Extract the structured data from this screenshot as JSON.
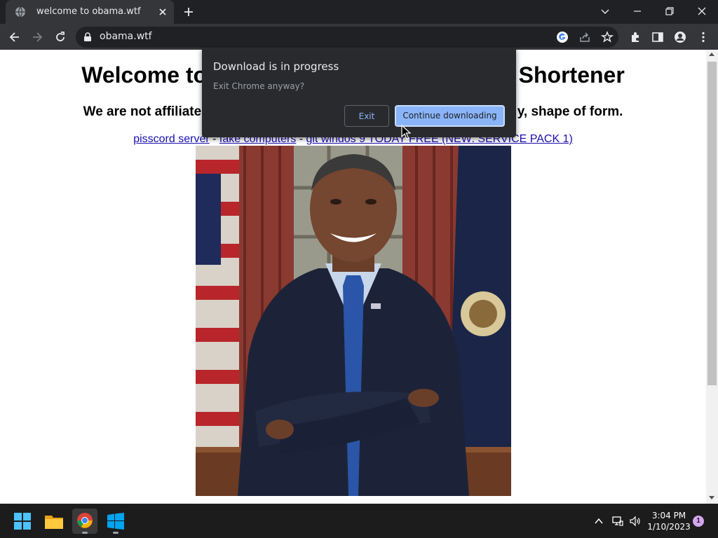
{
  "browser": {
    "tab": {
      "title": "welcome to obama.wtf",
      "favicon": "globe-icon"
    },
    "omnibox": {
      "url": "obama.wtf"
    }
  },
  "page": {
    "heading_left": "Welcome to",
    "heading_right": "k Shortener",
    "subheading_left": "We are not affiliate",
    "subheading_right": "y, shape of form.",
    "links": [
      {
        "text": "pisscord server"
      },
      {
        "text": "fake computers"
      },
      {
        "text": "git windos 9 TODAY FREE (NEW: SERVICE PACK 1)"
      }
    ],
    "link_separator": " - ",
    "image": "portrait-photo"
  },
  "dialog": {
    "title": "Download is in progress",
    "body": "Exit Chrome anyway?",
    "exit_label": "Exit",
    "continue_label": "Continue downloading"
  },
  "taskbar": {
    "apps": [
      "start-icon",
      "file-explorer-icon",
      "chrome-icon",
      "windows-icon"
    ],
    "clock_time": "3:04 PM",
    "clock_date": "1/10/2023",
    "notification_count": "1"
  },
  "colors": {
    "accent": "#8ab4f8",
    "page_bg": "#ffffff",
    "chrome_dark": "#202124"
  }
}
